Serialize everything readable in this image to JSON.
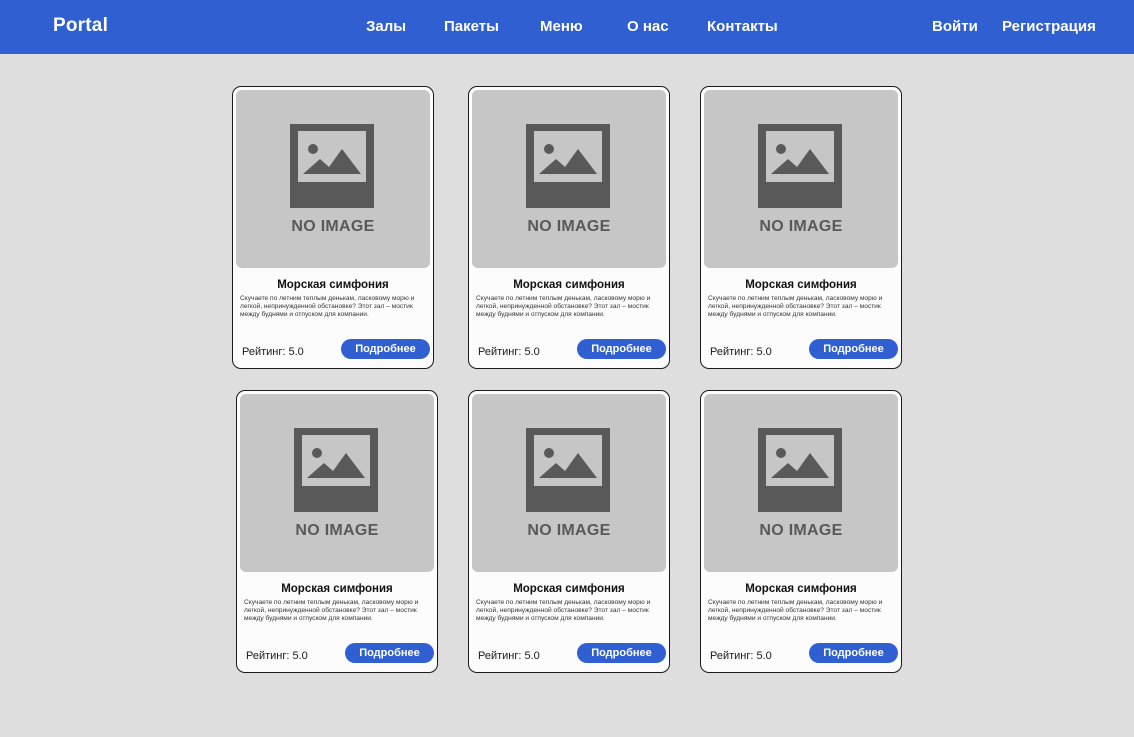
{
  "header": {
    "brand": "Portal",
    "nav": [
      "Залы",
      "Пакеты",
      "Меню",
      "О нас",
      "Контакты"
    ],
    "login": "Войти",
    "register": "Регистрация"
  },
  "cards": [
    {
      "image_text": "NO IMAGE",
      "title": "Морская симфония",
      "description": "Скучаете по летним теплым денькам, ласковому морю и легкой, непринужденной обстановке? Этот зал – мостик между буднями и отпуском для компании.",
      "rating": "Рейтинг: 5.0",
      "button": "Подробнее"
    },
    {
      "image_text": "NO IMAGE",
      "title": "Морская симфония",
      "description": "Скучаете по летним теплым денькам, ласковому морю и легкой, непринужденной обстановке? Этот зал – мостик между буднями и отпуском для компании.",
      "rating": "Рейтинг: 5.0",
      "button": "Подробнее"
    },
    {
      "image_text": "NO IMAGE",
      "title": "Морская симфония",
      "description": "Скучаете по летним теплым денькам, ласковому морю и легкой, непринужденной обстановке? Этот зал – мостик между буднями и отпуском для компании.",
      "rating": "Рейтинг: 5.0",
      "button": "Подробнее"
    },
    {
      "image_text": "NO IMAGE",
      "title": "Морская симфония",
      "description": "Скучаете по летним теплым денькам, ласковому морю и легкой, непринужденной обстановке? Этот зал – мостик между буднями и отпуском для компании.",
      "rating": "Рейтинг: 5.0",
      "button": "Подробнее"
    },
    {
      "image_text": "NO IMAGE",
      "title": "Морская симфония",
      "description": "Скучаете по летним теплым денькам, ласковому морю и легкой, непринужденной обстановке? Этот зал – мостик между буднями и отпуском для компании.",
      "rating": "Рейтинг: 5.0",
      "button": "Подробнее"
    },
    {
      "image_text": "NO IMAGE",
      "title": "Морская симфония",
      "description": "Скучаете по летним теплым денькам, ласковому морю и легкой, непринужденной обстановке? Этот зал – мостик между буднями и отпуском для компании.",
      "rating": "Рейтинг: 5.0",
      "button": "Подробнее"
    }
  ],
  "colors": {
    "accent": "#2f5fd0",
    "background": "#dfdedf",
    "card": "#fdfcfc",
    "image_placeholder": "#c6c6c6",
    "icon": "#595959"
  },
  "icons": {
    "card_image": "image-placeholder-icon"
  }
}
